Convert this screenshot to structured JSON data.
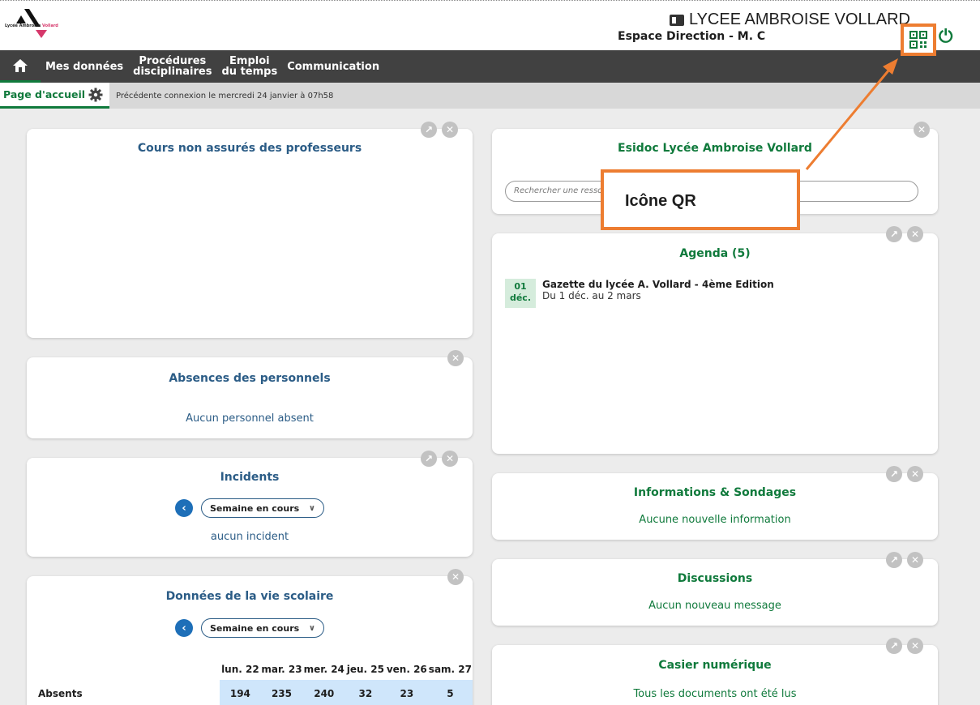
{
  "header": {
    "logo_name": "Lycée Ambroise",
    "logo_accent": "Vollard",
    "school_name": "LYCEE AMBROISE VOLLARD",
    "space_label": "Espace Direction - M. C"
  },
  "nav": {
    "items": [
      "Mes données",
      "Procédures\ndisciplinaires",
      "Emploi\ndu temps",
      "Communication"
    ]
  },
  "subnav": {
    "tab_label": "Page d'accueil",
    "previous_connection": "Précédente connexion le mercredi 24 janvier à 07h58"
  },
  "widgets": {
    "cours": {
      "title": "Cours non assurés des professeurs"
    },
    "absences": {
      "title": "Absences des personnels",
      "message": "Aucun personnel absent"
    },
    "incidents": {
      "title": "Incidents",
      "period": "Semaine en cours",
      "message": "aucun incident"
    },
    "vie_scolaire": {
      "title": "Données de la vie scolaire",
      "period": "Semaine en cours",
      "days": [
        "lun. 22",
        "mar. 23",
        "mer. 24",
        "jeu. 25",
        "ven. 26",
        "sam. 27"
      ],
      "rows": [
        {
          "label": "Absents",
          "values": [
            "194",
            "235",
            "240",
            "32",
            "23",
            "5"
          ]
        }
      ]
    },
    "esidoc": {
      "title": "Esidoc Lycée Ambroise Vollard",
      "search_placeholder": "Rechercher une ressource"
    },
    "agenda": {
      "title": "Agenda (5)",
      "events": [
        {
          "day": "01",
          "month": "déc.",
          "title": "Gazette du lycée A. Vollard - 4ème Edition",
          "range": "Du 1 déc. au 2 mars"
        }
      ]
    },
    "informations": {
      "title": "Informations & Sondages",
      "message": "Aucune nouvelle information"
    },
    "discussions": {
      "title": "Discussions",
      "message": "Aucun nouveau message"
    },
    "casier": {
      "title": "Casier numérique",
      "message": "Tous les documents ont été lus"
    }
  },
  "annotation": {
    "label": "Icône QR"
  },
  "colors": {
    "accent_green": "#107a3c",
    "title_blue": "#2b5c86",
    "annotation_orange": "#ed7d31",
    "nav_dark": "#414141"
  },
  "icons": [
    "home-icon",
    "gear-icon",
    "qr-code-icon",
    "power-icon",
    "expand-icon",
    "close-icon",
    "chevron-left-icon",
    "chevron-down-icon"
  ]
}
